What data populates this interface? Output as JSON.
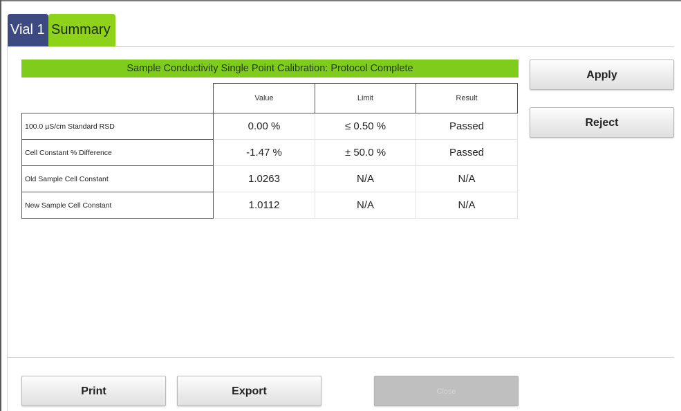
{
  "tabs": [
    {
      "label": "Vial 1"
    },
    {
      "label": "Summary"
    }
  ],
  "banner": {
    "title": "Sample Conductivity Single Point Calibration: Protocol Complete"
  },
  "table": {
    "headers": [
      "Value",
      "Limit",
      "Result"
    ],
    "rows": [
      {
        "label": "100.0 µS/cm Standard RSD",
        "value": "0.00 %",
        "limit": "≤ 0.50 %",
        "result": "Passed"
      },
      {
        "label": "Cell Constant % Difference",
        "value": "-1.47 %",
        "limit": "± 50.0 %",
        "result": "Passed"
      },
      {
        "label": "Old Sample Cell Constant",
        "value": "1.0263",
        "limit": "N/A",
        "result": "N/A"
      },
      {
        "label": "New Sample Cell Constant",
        "value": "1.0112",
        "limit": "N/A",
        "result": "N/A"
      }
    ]
  },
  "actions": {
    "apply": "Apply",
    "reject": "Reject"
  },
  "footer": {
    "print": "Print",
    "export": "Export",
    "close": "Close"
  },
  "colors": {
    "tab_vial": "#3d4a82",
    "tab_summary": "#8ed21a",
    "banner": "#7fcc1d",
    "disabled_button": "#bfbfbf"
  }
}
